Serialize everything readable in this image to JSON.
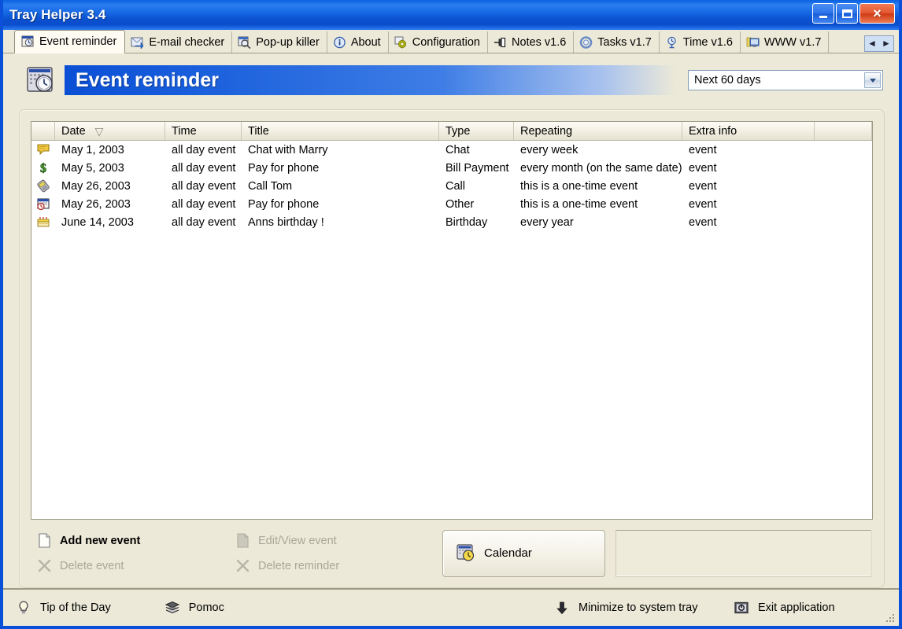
{
  "window": {
    "title": "Tray Helper  3.4",
    "controls": {
      "minimize": "minimize",
      "maximize": "maximize",
      "close": "×"
    }
  },
  "tabs": [
    {
      "label": "Event reminder",
      "icon": "event-reminder-icon",
      "active": true
    },
    {
      "label": "E-mail checker",
      "icon": "email-checker-icon",
      "active": false
    },
    {
      "label": "Pop-up killer",
      "icon": "popup-killer-icon",
      "active": false
    },
    {
      "label": "About",
      "icon": "about-info-icon",
      "active": false
    },
    {
      "label": "Configuration",
      "icon": "configuration-gears-icon",
      "active": false
    },
    {
      "label": "Notes v1.6",
      "icon": "notes-pin-icon",
      "active": false
    },
    {
      "label": "Tasks v1.7",
      "icon": "tasks-gear-icon",
      "active": false
    },
    {
      "label": "Time v1.6",
      "icon": "time-clock-icon",
      "active": false
    },
    {
      "label": "WWW v1.7",
      "icon": "www-monitor-icon",
      "active": false
    }
  ],
  "tab_scroll": {
    "left": "◄",
    "right": "►"
  },
  "header": {
    "title": "Event reminder",
    "icon": "calendar-clock-icon",
    "range_select": {
      "value": "Next 60 days",
      "options": [
        "Next 60 days"
      ]
    }
  },
  "list": {
    "columns": [
      {
        "key": "icon",
        "label": ""
      },
      {
        "key": "date",
        "label": "Date",
        "sorted": "descending"
      },
      {
        "key": "time",
        "label": "Time"
      },
      {
        "key": "title",
        "label": "Title"
      },
      {
        "key": "type",
        "label": "Type"
      },
      {
        "key": "rep",
        "label": "Repeating"
      },
      {
        "key": "extra",
        "label": "Extra info"
      }
    ],
    "rows": [
      {
        "icon": "chat-bubble-icon",
        "date": "May  1, 2003",
        "time": "all day event",
        "title": "Chat with Marry",
        "type": "Chat",
        "rep": "every week",
        "extra": "event"
      },
      {
        "icon": "dollar-money-icon",
        "date": "May  5, 2003",
        "time": "all day event",
        "title": "Pay for phone",
        "type": "Bill Payment",
        "rep": "every month (on the same date)",
        "extra": "event"
      },
      {
        "icon": "mobile-phone-icon",
        "date": "May 26, 2003",
        "time": "all day event",
        "title": "Call Tom",
        "type": "Call",
        "rep": "this is a one-time event",
        "extra": "event"
      },
      {
        "icon": "window-clock-icon",
        "date": "May 26, 2003",
        "time": "all day event",
        "title": "Pay for phone",
        "type": "Other",
        "rep": "this is a one-time event",
        "extra": "event"
      },
      {
        "icon": "birthday-cake-icon",
        "date": "June 14, 2003",
        "time": "all day event",
        "title": "Anns birthday !",
        "type": "Birthday",
        "rep": "every year",
        "extra": "event"
      }
    ]
  },
  "actions": {
    "add_new_event": {
      "label": "Add new event",
      "icon": "new-page-icon",
      "enabled": true
    },
    "delete_event": {
      "label": "Delete event",
      "icon": "x-delete-icon",
      "enabled": false
    },
    "edit_view_event": {
      "label": "Edit/View event",
      "icon": "edit-page-icon",
      "enabled": false
    },
    "delete_reminder": {
      "label": "Delete reminder",
      "icon": "x-delete-icon",
      "enabled": false
    },
    "calendar": {
      "label": "Calendar",
      "icon": "calendar-clock-icon",
      "enabled": true
    }
  },
  "statusbar": {
    "tip_of_the_day": {
      "label": "Tip of the Day",
      "icon": "lightbulb-icon"
    },
    "help": {
      "label": "Pomoc",
      "icon": "help-book-icon"
    },
    "minimize_tray": {
      "label": "Minimize to system tray",
      "icon": "down-arrow-icon"
    },
    "exit": {
      "label": "Exit application",
      "icon": "power-exit-icon"
    }
  },
  "colors": {
    "title_bar_blue": "#0a50d8",
    "banner_blue": "#0b4fd6",
    "window_face": "#ece9d8",
    "list_background": "#ffffff",
    "close_button_red": "#cf3c16",
    "disabled_text": "#aaa69a"
  }
}
